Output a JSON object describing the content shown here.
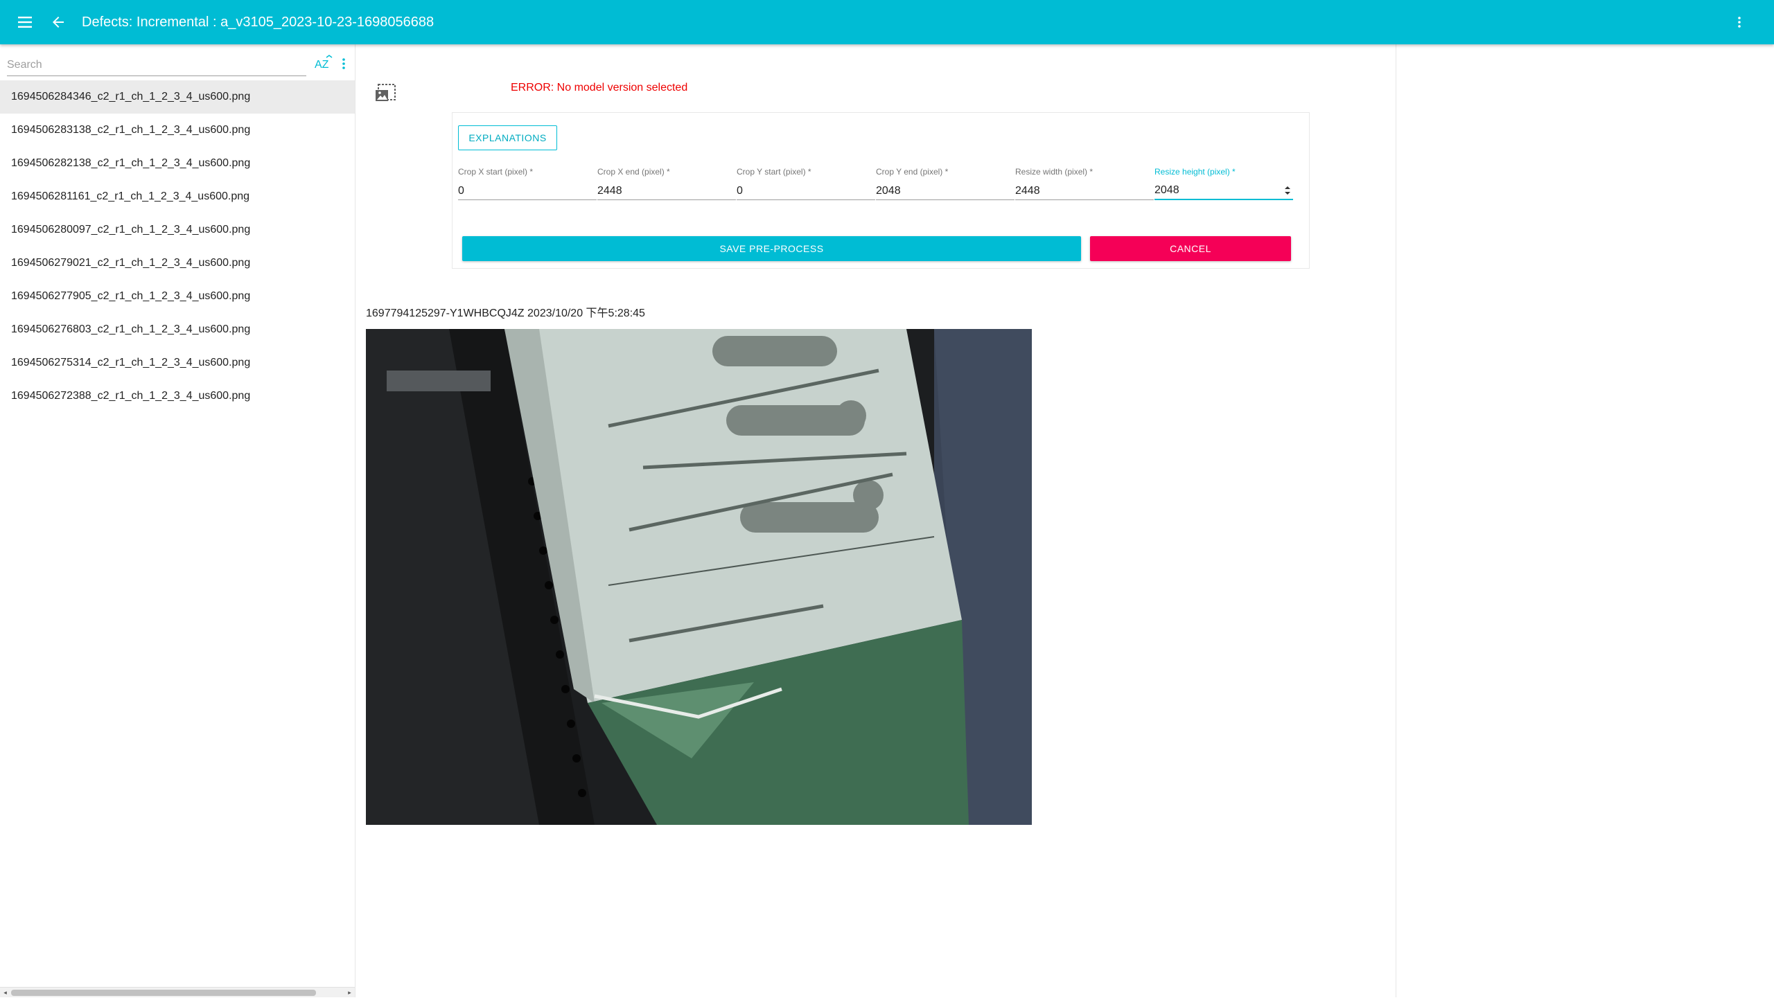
{
  "app_bar": {
    "title": "Defects: Incremental : a_v3105_2023-10-23-1698056688",
    "icons": [
      "menu-icon",
      "arrow-back-icon",
      "more-vert-icon"
    ],
    "color": "#00bcd4"
  },
  "sidebar": {
    "search_placeholder": "Search",
    "search_value": "",
    "sort_icon_label": "AZ",
    "files": [
      "1694506284346_c2_r1_ch_1_2_3_4_us600.png",
      "1694506283138_c2_r1_ch_1_2_3_4_us600.png",
      "1694506282138_c2_r1_ch_1_2_3_4_us600.png",
      "1694506281161_c2_r1_ch_1_2_3_4_us600.png",
      "1694506280097_c2_r1_ch_1_2_3_4_us600.png",
      "1694506279021_c2_r1_ch_1_2_3_4_us600.png",
      "1694506277905_c2_r1_ch_1_2_3_4_us600.png",
      "1694506276803_c2_r1_ch_1_2_3_4_us600.png",
      "1694506275314_c2_r1_ch_1_2_3_4_us600.png",
      "1694506272388_c2_r1_ch_1_2_3_4_us600.png"
    ],
    "selected_index": 0
  },
  "main": {
    "error": "ERROR: No model version selected",
    "explanations_label": "EXPLANATIONS",
    "fields": [
      {
        "label": "Crop X start (pixel) *",
        "value": "0"
      },
      {
        "label": "Crop X end (pixel) *",
        "value": "2448"
      },
      {
        "label": "Crop Y start (pixel) *",
        "value": "0"
      },
      {
        "label": "Crop Y end (pixel) *",
        "value": "2048"
      },
      {
        "label": "Resize width (pixel) *",
        "value": "2448"
      },
      {
        "label": "Resize height (pixel) *",
        "value": "2048"
      }
    ],
    "save_label": "SAVE PRE-PROCESS",
    "cancel_label": "CANCEL",
    "image_caption": "1697794125297-Y1WHBCQJ4Z 2023/10/20 下午5:28:45",
    "colors": {
      "accent": "#00bcd4",
      "cancel": "#f50057",
      "error": "#e00000"
    }
  }
}
